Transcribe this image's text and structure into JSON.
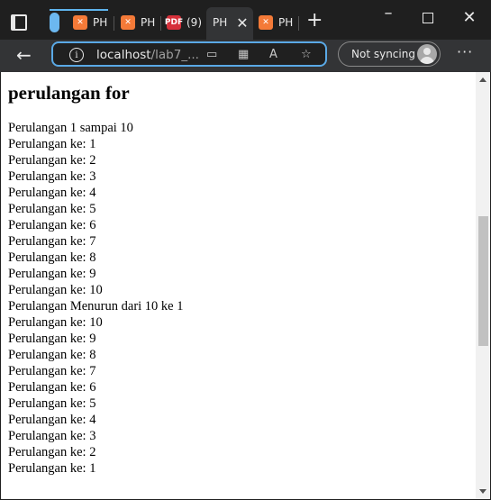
{
  "browser": {
    "tabs": [
      {
        "label": "PH",
        "icon": "xampp-icon",
        "active": false
      },
      {
        "label": "PH",
        "icon": "xampp-icon",
        "active": false
      },
      {
        "label": "(9)",
        "icon": "pdf-icon",
        "active": false
      },
      {
        "label": "PH",
        "icon": "xampp-icon",
        "active": true
      },
      {
        "label": "PH",
        "icon": "xampp-icon",
        "active": false
      }
    ],
    "url_host": "localhost",
    "url_path": "/lab7_...",
    "sync_label": "Not syncing",
    "accent_color": "#5aa9e6"
  },
  "page": {
    "heading": "perulangan for",
    "lines": [
      "Perulangan 1 sampai 10",
      "Perulangan ke: 1",
      "Perulangan ke: 2",
      "Perulangan ke: 3",
      "Perulangan ke: 4",
      "Perulangan ke: 5",
      "Perulangan ke: 6",
      "Perulangan ke: 7",
      "Perulangan ke: 8",
      "Perulangan ke: 9",
      "Perulangan ke: 10",
      "Perulangan Menurun dari 10 ke 1",
      "Perulangan ke: 10",
      "Perulangan ke: 9",
      "Perulangan ke: 8",
      "Perulangan ke: 7",
      "Perulangan ke: 6",
      "Perulangan ke: 5",
      "Perulangan ke: 4",
      "Perulangan ke: 3",
      "Perulangan ke: 2",
      "Perulangan ke: 1"
    ]
  }
}
